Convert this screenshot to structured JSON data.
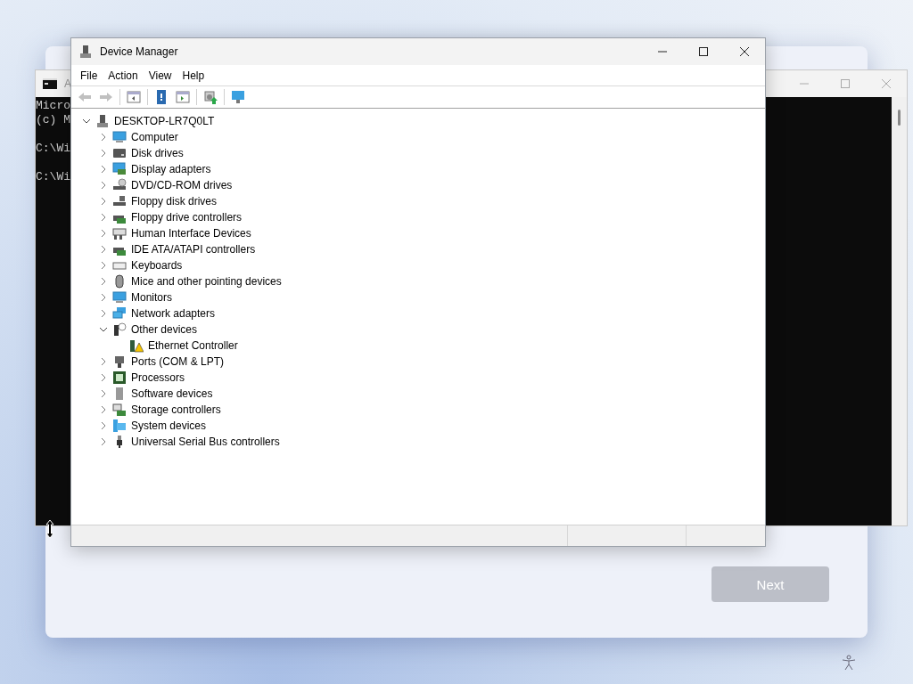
{
  "console_window": {
    "title": "A",
    "paragraphs": [
      [
        "Micro",
        "(c) M"
      ],
      [
        "C:\\Wi"
      ],
      [
        "C:\\Wi"
      ]
    ]
  },
  "device_manager": {
    "title": "Device Manager",
    "menu": [
      "File",
      "Action",
      "View",
      "Help"
    ],
    "toolbar": [
      {
        "kind": "back",
        "disabled": true
      },
      {
        "kind": "forward",
        "disabled": true
      },
      {
        "kind": "sep"
      },
      {
        "kind": "properties-pane"
      },
      {
        "kind": "sep"
      },
      {
        "kind": "help"
      },
      {
        "kind": "action-pane"
      },
      {
        "kind": "sep"
      },
      {
        "kind": "scan"
      },
      {
        "kind": "sep"
      },
      {
        "kind": "monitor"
      }
    ],
    "tree": {
      "label": "DESKTOP-LR7Q0LT",
      "kind": "pc",
      "expanded": true,
      "children": [
        {
          "label": "Computer",
          "kind": "computer",
          "expanded": false
        },
        {
          "label": "Disk drives",
          "kind": "disk",
          "expanded": false
        },
        {
          "label": "Display adapters",
          "kind": "display",
          "expanded": false
        },
        {
          "label": "DVD/CD-ROM drives",
          "kind": "dvd",
          "expanded": false
        },
        {
          "label": "Floppy disk drives",
          "kind": "floppy",
          "expanded": false
        },
        {
          "label": "Floppy drive controllers",
          "kind": "floppy-controller",
          "expanded": false
        },
        {
          "label": "Human Interface Devices",
          "kind": "hid",
          "expanded": false
        },
        {
          "label": "IDE ATA/ATAPI controllers",
          "kind": "ide",
          "expanded": false
        },
        {
          "label": "Keyboards",
          "kind": "keyboard",
          "expanded": false
        },
        {
          "label": "Mice and other pointing devices",
          "kind": "mouse",
          "expanded": false
        },
        {
          "label": "Monitors",
          "kind": "monitor",
          "expanded": false
        },
        {
          "label": "Network adapters",
          "kind": "network",
          "expanded": false
        },
        {
          "label": "Other devices",
          "kind": "other",
          "expanded": true,
          "children": [
            {
              "label": "Ethernet Controller",
              "kind": "warning-device"
            }
          ]
        },
        {
          "label": "Ports (COM & LPT)",
          "kind": "port",
          "expanded": false
        },
        {
          "label": "Processors",
          "kind": "processor",
          "expanded": false
        },
        {
          "label": "Software devices",
          "kind": "software",
          "expanded": false
        },
        {
          "label": "Storage controllers",
          "kind": "storage",
          "expanded": false
        },
        {
          "label": "System devices",
          "kind": "system",
          "expanded": false
        },
        {
          "label": "Universal Serial Bus controllers",
          "kind": "usb",
          "expanded": false
        }
      ]
    }
  },
  "setup": {
    "next_button": {
      "label": "Next",
      "disabled": true
    }
  }
}
